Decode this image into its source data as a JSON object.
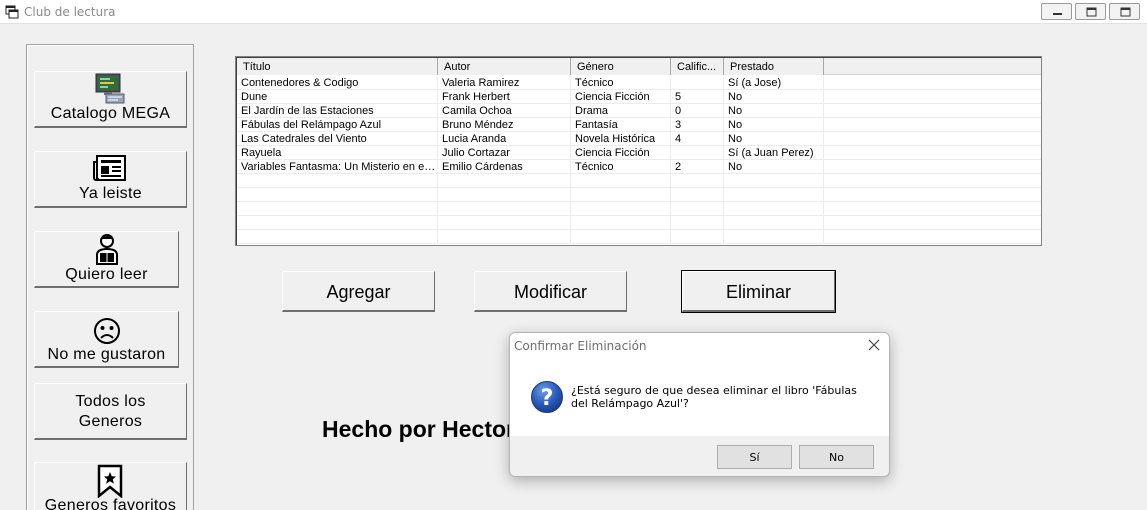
{
  "window": {
    "title": "Club de lectura"
  },
  "sidebar": {
    "items": [
      {
        "label": "Catalogo MEGA",
        "icon": "computer-icon"
      },
      {
        "label": "Ya  leiste",
        "icon": "newspaper-icon"
      },
      {
        "label": "Quiero leer",
        "icon": "reader-icon"
      },
      {
        "label": "No me gustaron",
        "icon": "sad-face-icon"
      },
      {
        "label_line1": "Todos los",
        "label_line2": "Generos"
      },
      {
        "label": "Generos favoritos",
        "icon": "bookmark-star-icon"
      }
    ]
  },
  "table": {
    "columns": [
      "Título",
      "Autor",
      "Género",
      "Calific...",
      "Prestado"
    ],
    "rows": [
      [
        "Contenedores & Codigo",
        "Valeria Ramirez",
        "Técnico",
        "",
        "Sí (a Jose)"
      ],
      [
        "Dune",
        "Frank Herbert",
        "Ciencia Ficción",
        "5",
        "No"
      ],
      [
        "El Jardín de las Estaciones",
        "Camila Ochoa",
        "Drama",
        "0",
        "No"
      ],
      [
        "Fábulas del Relámpago Azul",
        "Bruno Méndez",
        "Fantasía",
        "3",
        "No"
      ],
      [
        "Las Catedrales del Viento",
        "Lucia Aranda",
        "Novela Histórica",
        "4",
        "No"
      ],
      [
        "Rayuela",
        "Julio Cortazar",
        "Ciencia Ficción",
        "",
        "Sí (a Juan Perez)"
      ],
      [
        "Variables Fantasma: Un Misterio en el Código",
        "Emilio Cárdenas",
        "Técnico",
        "2",
        "No"
      ]
    ]
  },
  "actions": {
    "add": "Agregar",
    "edit": "Modificar",
    "delete": "Eliminar"
  },
  "footer": {
    "made_by": "Hecho por Hector"
  },
  "dialog": {
    "title": "Confirmar Eliminación",
    "message": "¿Está seguro de que desea eliminar el libro 'Fábulas del Relámpago Azul'?",
    "yes": "Sí",
    "no": "No",
    "icon": "question-icon"
  },
  "colors": {
    "question_blue": "#1f4fa8",
    "window_bg": "#f0f0f0"
  }
}
